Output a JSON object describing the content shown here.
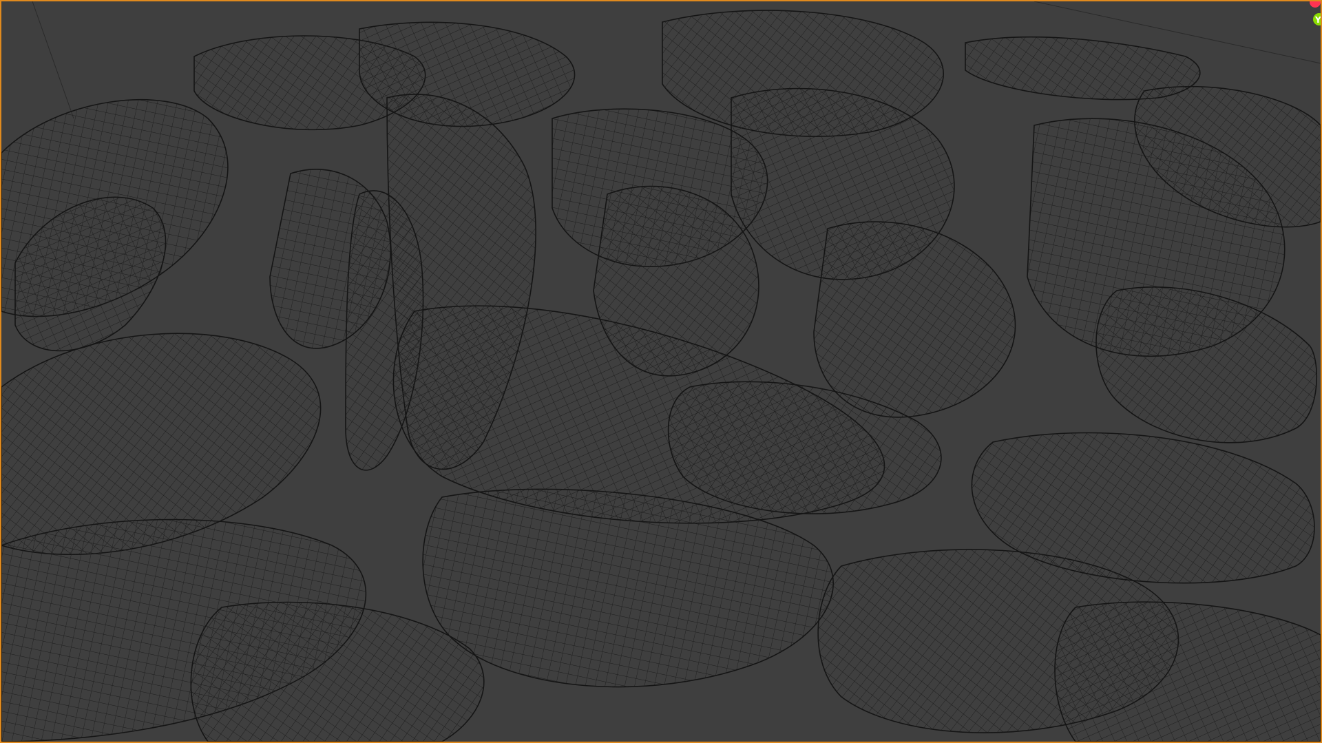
{
  "app": {
    "title": "",
    "mode": "",
    "shading": "wireframe"
  },
  "viewport": {
    "background_color": "#3f3f3f",
    "active_border_color": "#e08a1e",
    "wire_color": "#1a1a1a",
    "surface_color": "#444444"
  },
  "gizmo": {
    "x_axis_color": "#ff3352",
    "y_axis_color": "#8bdc00",
    "x_axis_label": "",
    "y_axis_label": "Y"
  }
}
